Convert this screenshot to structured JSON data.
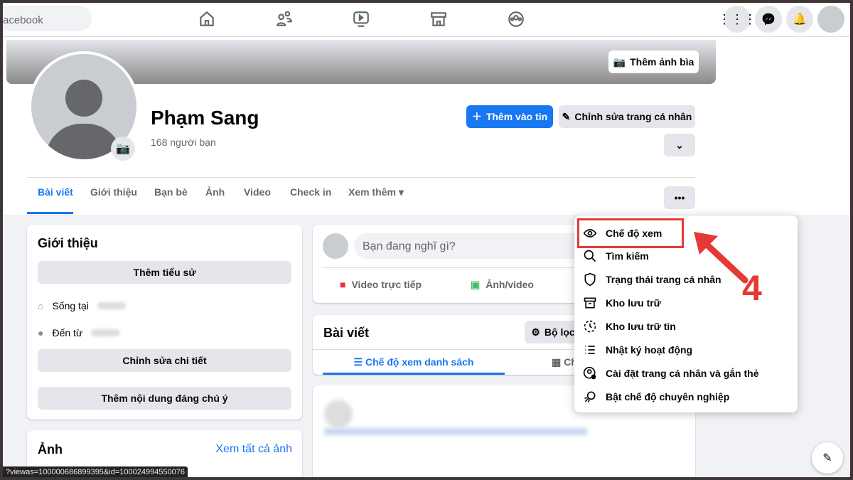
{
  "topbar": {
    "search_text": "acebook"
  },
  "profile": {
    "name": "Phạm Sang",
    "friends": "168 người bạn",
    "cover_button": "Thêm ảnh bìa",
    "add_story": "Thêm vào tin",
    "edit_profile": "Chỉnh sửa trang cá nhân"
  },
  "tabs": [
    "Bài viết",
    "Giới thiệu",
    "Bạn bè",
    "Ảnh",
    "Video",
    "Check in",
    "Xem thêm"
  ],
  "intro": {
    "title": "Giới thiệu",
    "add_bio": "Thêm tiểu sử",
    "lives_in": "Sống tại",
    "from": "Đến từ",
    "edit_details": "Chỉnh sửa chi tiết",
    "add_featured": "Thêm nội dung đáng chú ý"
  },
  "photos": {
    "title": "Ảnh",
    "see_all": "Xem tất cả ảnh"
  },
  "composer": {
    "placeholder": "Bạn đang nghĩ gì?",
    "live": "Video trực tiếp",
    "photo": "Ảnh/video"
  },
  "posts": {
    "title": "Bài viết",
    "filter": "Bộ lọc",
    "list_view": "Chế độ xem danh sách",
    "grid_view": "Ch"
  },
  "menu": {
    "items": [
      "Chế độ xem",
      "Tìm kiếm",
      "Trạng thái trang cá nhân",
      "Kho lưu trữ",
      "Kho lưu trữ tin",
      "Nhật ký hoạt động",
      "Cài đặt trang cá nhân và gắn thẻ",
      "Bật chế độ chuyên nghiệp"
    ]
  },
  "annotation": {
    "step": "4",
    "color": "#e53935"
  },
  "status_url": "?viewas=100000686899395&id=100024994550076"
}
